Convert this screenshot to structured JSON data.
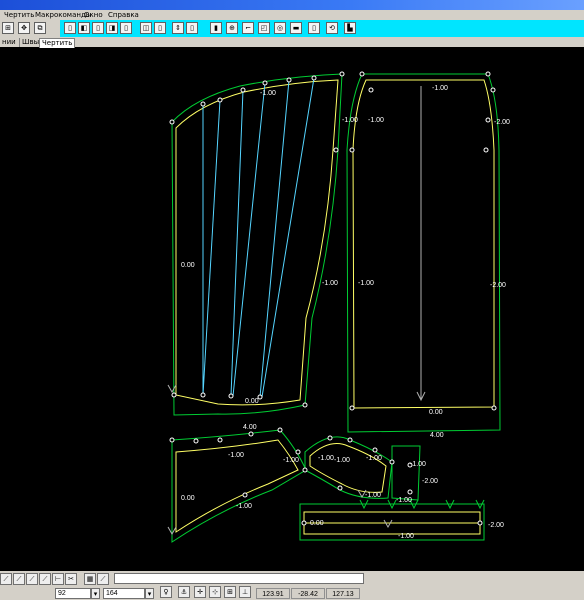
{
  "menu": {
    "items": [
      "Чертить",
      "Макрокоманды",
      "Окно",
      "Справка"
    ]
  },
  "toolbar": {
    "buttons": [
      "b1",
      "b2",
      "b3",
      "b4",
      "b5",
      "b6",
      "b7",
      "b8",
      "b9",
      "b10",
      "b11",
      "b12",
      "b13",
      "b14",
      "b15",
      "b16",
      "b17",
      "b18",
      "b19",
      "b20",
      "b21",
      "b22"
    ]
  },
  "tabs": {
    "items": [
      "нии",
      "Швы",
      "Чертить"
    ],
    "active": "Чертить"
  },
  "labels": {
    "l1": "-1.00",
    "l2": "-1.00",
    "l3": "-1.00",
    "l4": "-2.00",
    "l5": "-1.00",
    "l6": "0.00",
    "l7": "-1.00",
    "l8": "-1.00",
    "l9": "-2.00",
    "l10": "0.00",
    "l11": "0.00",
    "l12": "4.00",
    "l13": "4.00",
    "l14": "-1.00",
    "l15": "-1.00",
    "l16": "-1.00",
    "l17": "-1.00",
    "l18": "-1.00",
    "l19": "-1.00",
    "l20": "-2.00",
    "l21": "-1.00",
    "l22": "-1.00",
    "l23": "0.00",
    "l24": "-1.00",
    "l25": "0.00",
    "l26": "-1.00",
    "l27": "-2.00"
  },
  "status": {
    "field_a": "92",
    "field_b": "164",
    "coord_x": "123.91",
    "coord_y": "-28.42",
    "coord_z": "127.13"
  },
  "colors": {
    "pattern_line": "#ffff66",
    "seam_line": "#00cc33",
    "grain_line": "#55d5ff",
    "point": "#ffffff",
    "toolbar_bg": "#00e5ff"
  }
}
